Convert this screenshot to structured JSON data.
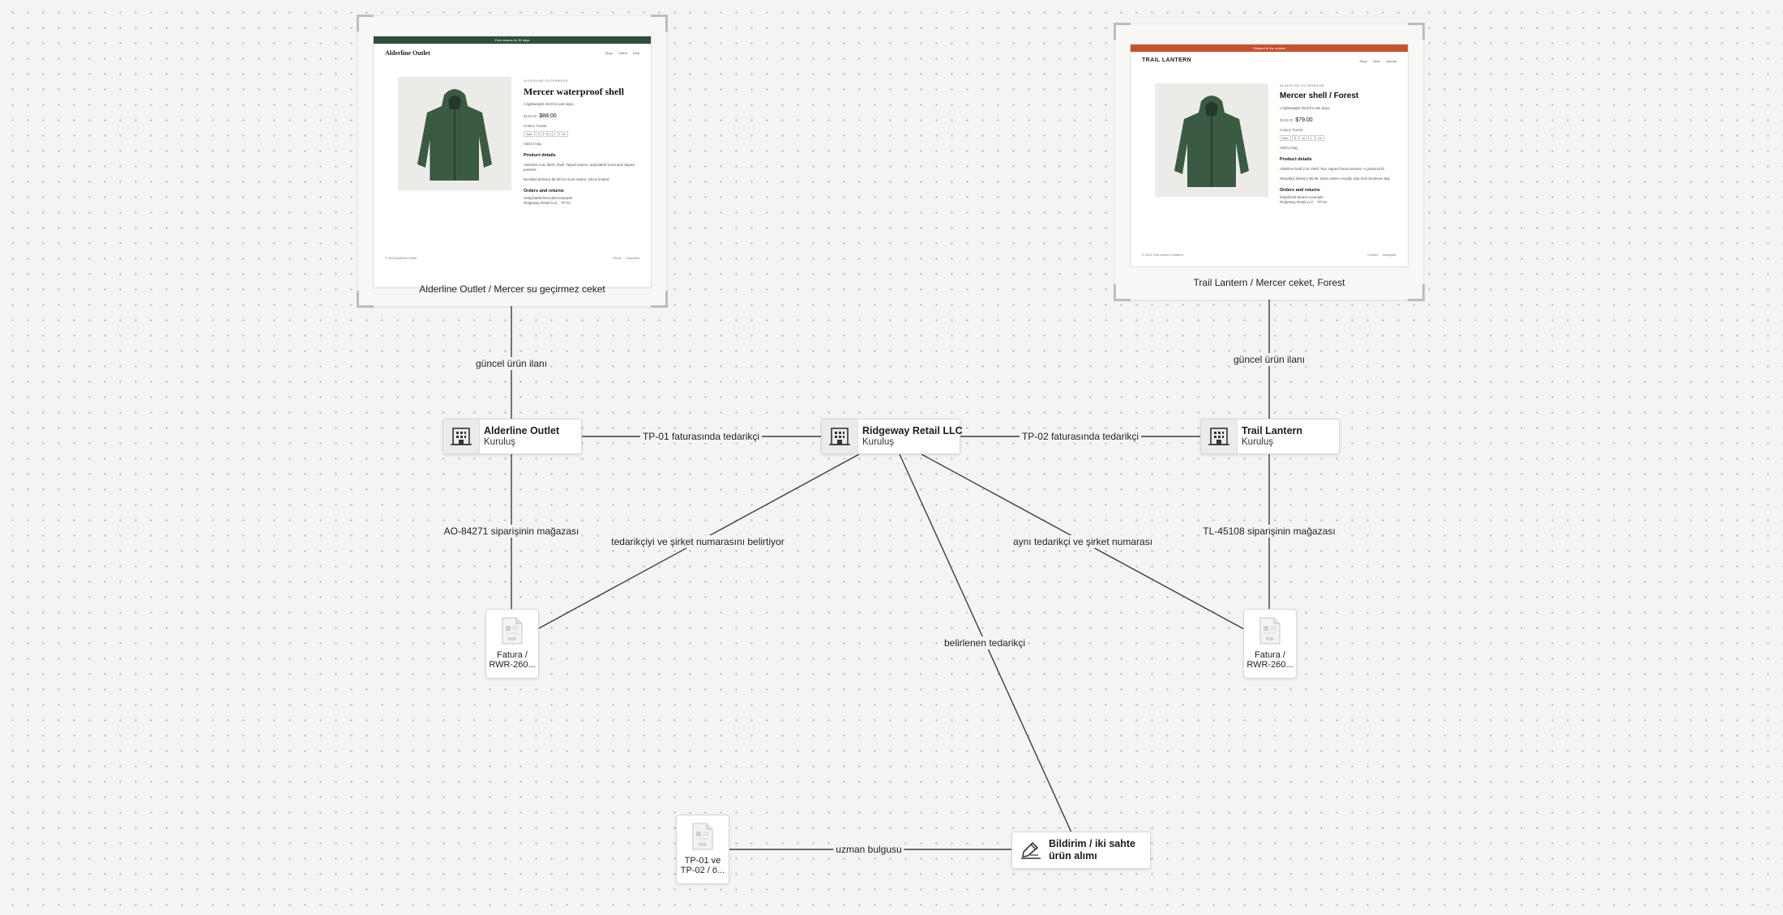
{
  "colors": {
    "alderline_banner": "#2f4f3a",
    "trail_banner": "#c5532e",
    "jacket": "#3b5a44",
    "edge": "#3d3d3d"
  },
  "websites": {
    "alderline": {
      "caption": "Alderline Outlet / Mercer su geçirmez ceket",
      "page": {
        "banner": "Free returns for 30 days",
        "logo": "Alderline Outlet",
        "nav": "Shop Outlet Help",
        "eyebrow": "ALDERLINE OUTERWEAR",
        "title": "Mercer waterproof shell",
        "subtitle": "A lightweight shell for wet days.",
        "old_price": "$129.00",
        "price": "$88.00",
        "colour": "Colour: Forest",
        "size_label": "Size",
        "sizes": [
          "S",
          "M",
          "L",
          "XL"
        ],
        "sizeguide": "Add to bag",
        "details_title": "Product details",
        "details_1": "Alderline 2.5L fabric shell. Taped seams, adjustable hood and zipped pockets.",
        "details_2": "Bundled delivery $5.95 for most orders. Stock limited.",
        "orders_title": "Orders and returns",
        "orders_1": "Help@alderlineoutlet.example",
        "orders_2": "Ridgeway Retail LLC · TP-01",
        "footer_left": "© 2024 Alderline Outlet",
        "footer_right": "Email Facebook"
      }
    },
    "trail": {
      "caption": "Trail Lantern / Mercer ceket, Forest",
      "page": {
        "banner": "Shipped to the outside",
        "logo": "TRAIL LANTERN",
        "nav": "Shop Gear Journal",
        "eyebrow": "ALDERLINE OUTERWEAR",
        "title": "Mercer shell / Forest",
        "subtitle": "A lightweight shell for wet days.",
        "old_price": "$109.00",
        "price": "$79.00",
        "colour": "Colour: Forest",
        "size_label": "Size",
        "sizes": [
          "S",
          "M",
          "L",
          "XL"
        ],
        "sizeguide": "Add to bag",
        "details_title": "Product details",
        "details_1": "Alderline-built 2.5L shell. Two zipped hand pockets. A practical fit.",
        "details_2": "Standard delivery $6.95. Most orders usually ship next business day.",
        "orders_title": "Orders and returns",
        "orders_1": "help@trail-lantern.example",
        "orders_2": "Ridgeway Retail LLC · TP-02",
        "footer_left": "© 2024 Trail Lantern Outfitters",
        "footer_right": "Contact Instagram"
      }
    }
  },
  "entities": {
    "alderline": {
      "title": "Alderline Outlet",
      "subtitle": "Kuruluş",
      "icon": "building-icon"
    },
    "ridgeway": {
      "title": "Ridgeway Retail LLC",
      "subtitle": "Kuruluş",
      "icon": "building-icon"
    },
    "trail": {
      "title": "Trail Lantern",
      "subtitle": "Kuruluş",
      "icon": "building-icon"
    }
  },
  "documents": {
    "invoice1": {
      "label": "Fatura / RWR-260...",
      "icon": "pdf-file-icon",
      "file_tag": "PDF"
    },
    "invoice2": {
      "label": "Fatura / RWR-260...",
      "icon": "pdf-file-icon",
      "file_tag": "PDF"
    },
    "tp_docs": {
      "label": "TP-01 ve TP-02 / ö...",
      "icon": "pdf-file-icon",
      "file_tag": "PDF"
    }
  },
  "finding": {
    "title": "Bildirim / iki sahte ürün alımı",
    "icon": "pen-icon"
  },
  "edges": {
    "alderline_site": "güncel ürün ilanı",
    "trail_site": "güncel ürün ilanı",
    "tp01": "TP-01 faturasında tedarikçi",
    "tp02": "TP-02 faturasında tedarikçi",
    "ao_order": "AO-84271 siparişinin mağazası",
    "tl_order": "TL-45108 siparişinin mağazası",
    "supplier_id": "tedarikçiyi ve şirket numarasını belirtiyor",
    "same_supplier": "aynı tedarikçi ve şirket numarası",
    "named_supplier": "belirlenen tedarikçi",
    "expert": "uzman bulgusu"
  }
}
